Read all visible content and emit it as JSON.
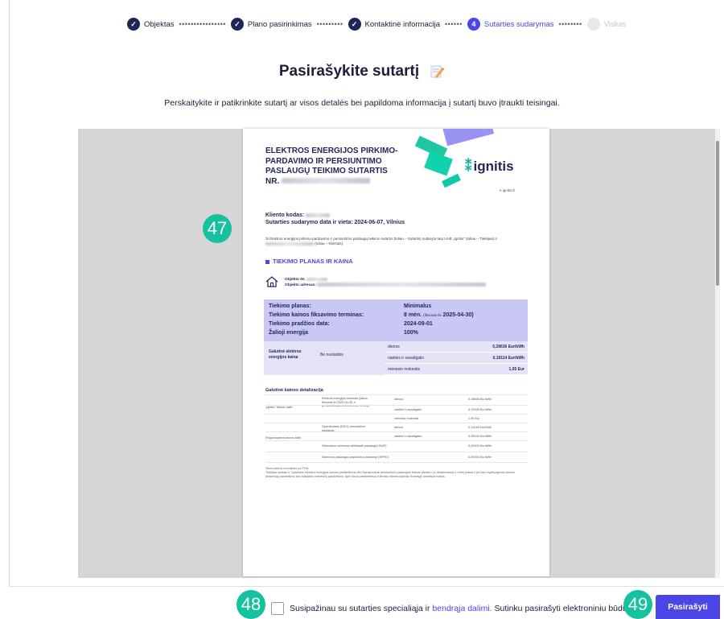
{
  "stepper": {
    "steps": [
      {
        "label": "Objektas",
        "state": "done"
      },
      {
        "label": "Plano pasirinkimas",
        "state": "done"
      },
      {
        "label": "Kontaktinė informacija",
        "state": "done"
      },
      {
        "label": "Sutarties sudarymas",
        "number": "4",
        "state": "active"
      },
      {
        "label": "Viskas",
        "state": "disabled"
      }
    ]
  },
  "header": {
    "title": "Pasirašykite sutartį",
    "subtitle": "Perskaitykite ir patikrinkite sutartį ar visos detalės bei papildoma informacija į sutartį buvo įtraukti teisingai."
  },
  "document": {
    "title": "ELEKTROS ENERGIJOS PIRKIMO-PARDAVIMO IR PERSIUNTIMO PASLAUGŲ TEIKIMO SUTARTIS",
    "number_label": "NR.",
    "logo_text": "ignitis",
    "logo_url_text": "e.ignitis.lt",
    "client_code_label": "Kliento kodas:",
    "date_place": "Sutarties sudarymo data ir vieta: 2024-06-07, Vilnius",
    "intro": "Ši Elektros energijos pirkimo-pardavimo ir persiuntimo paslaugų teikimo sutartis (toliau – Sutartis) sudaryta tarp UAB „Ignitis\" (toliau – Tiekėjas) ir",
    "intro_tail": "(toliau – Klientas).",
    "section_heading": "TIEKIMO PLANAS IR KAINA",
    "object_no_label": "Objekto Nr.",
    "object_address_label": "Objekto adresas:",
    "plan_rows": [
      {
        "label": "Tiekimo planas:",
        "value": "Minimalus"
      },
      {
        "label": "Tiekimo kainos fiksavimo terminas:",
        "value": "8 mėn.",
        "value_small": "(fiksuota iki",
        "value_date": "2025-04-30)"
      },
      {
        "label": "Tiekimo pradžios data:",
        "value": "2024-09-01"
      },
      {
        "label": "Žalioji energija",
        "value": "100%"
      }
    ],
    "final_price_label": "Galutinė elektros energijos kaina",
    "final_price_mid": "Be nuolaidos",
    "price_rows": [
      {
        "label": "dienos",
        "value": "0,28636 Eur/kWh"
      },
      {
        "label": "nakties ir savaitgalio",
        "value": "0,19114 Eur/kWh"
      },
      {
        "label": "mėnesio mokestis",
        "value": "1,05 Eur"
      }
    ],
    "detail_heading": "Galutinė kainos detalizacija",
    "detail_rows": [
      {
        "group": "„Ignitis\" kainos dalis",
        "item": "Elektros energijos tiekimas (kaina fiksuota iki 2025-04-30, ir perskaičiuojama kiekvieną mėnesį)",
        "period": "dienos",
        "value": "0,16666 Eur/kWh"
      },
      {
        "group": "",
        "item": "",
        "period": "nakties ir savaitgalio",
        "value": "0,12528 Eur/kWh"
      },
      {
        "group": "",
        "item": "",
        "period": "mėnesio mokestis",
        "value": "1,05 Eur"
      },
      {
        "group": "Reguliuojama kainos dalis",
        "item": "Operatoriaus (ESO) persiuntimo paslauga",
        "period": "dienos",
        "value": "0,11418 Eur/kWh"
      },
      {
        "group": "",
        "item": "",
        "period": "nakties ir savaitgalio",
        "value": "0,06034 Eur/kWh"
      },
      {
        "group": "",
        "item": "Viešuosius interesus atitinkanti paslauga (VIAP)",
        "period": "",
        "value": "0,00000 Eur/kWh"
      },
      {
        "group": "",
        "item": "Sistemos paslaugos papildoma dedamoji (SPPD)",
        "period": "",
        "value": "0,00054 Eur/kWh"
      }
    ],
    "footnote_1": "Visos kainos nurodytos su PVM.",
    "footnote_2": "Tiekėjas nustato ir Galutinės elektros energijos kainos pasikeitimus dėl Operatoriaus persiuntimo paslaugos kainos (tarifai ir jų dedamosios) ir tarifų planai ir jei kitų reguliuojamos kainos dedamųjų pasikeitimo bei valstybės mokesčių pasikeitimo. Apie šiuos pasikeitimus Klientas informuojamas Sutartyje nustatyta tvarka."
  },
  "badges": {
    "doc": "47",
    "checkbox": "48",
    "button": "49"
  },
  "footer": {
    "consent_before": "Susipažinau su sutarties specialiąja ir",
    "consent_link": "bendrąja dalimi.",
    "consent_after": "Sutinku pasirašyti elektroniniu būdu.",
    "sign_button": "Pasirašyti"
  },
  "colors": {
    "accent": "#4b46e5",
    "badge": "#16c1a0",
    "navy": "#1f2557"
  }
}
